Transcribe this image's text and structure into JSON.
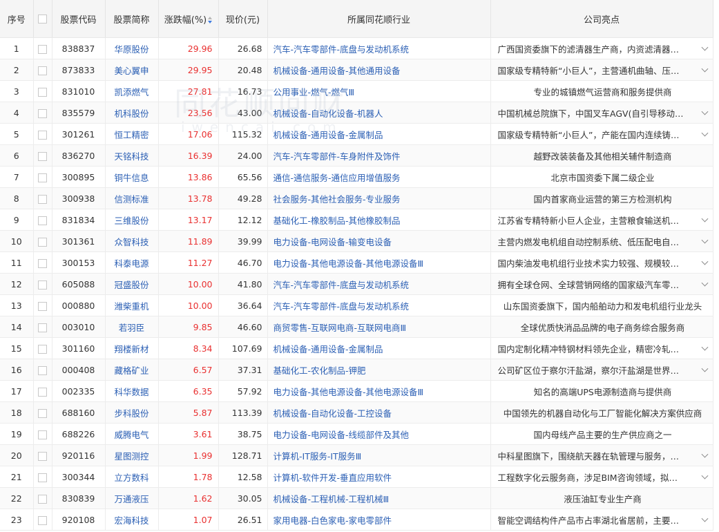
{
  "header": {
    "idx": "序号",
    "code": "股票代码",
    "name": "股票简称",
    "change": "涨跌幅(%)",
    "price": "现价(元)",
    "industry": "所属同花顺行业",
    "highlight": "公司亮点"
  },
  "watermark": {
    "main": "同花顺问财",
    "sub": "iwencai.com"
  },
  "colors": {
    "up": "#e93030",
    "link": "#2b5fb4"
  },
  "rows": [
    {
      "idx": "1",
      "code": "838837",
      "name": "华原股份",
      "change": "29.96",
      "price": "26.68",
      "industry": "汽车-汽车零部件-底盘与发动机系统",
      "highlight": "广西国资委旗下的滤清器生产商，内资滤清器…",
      "expandable": true
    },
    {
      "idx": "2",
      "code": "873833",
      "name": "美心翼申",
      "change": "29.95",
      "price": "20.48",
      "industry": "机械设备-通用设备-其他通用设备",
      "highlight": "国家级专精特新“小巨人”，主营通机曲轴、压…",
      "expandable": true
    },
    {
      "idx": "3",
      "code": "831010",
      "name": "凯添燃气",
      "change": "27.81",
      "price": "16.73",
      "industry": "公用事业-燃气-燃气Ⅲ",
      "highlight": "专业的城镇燃气运营商和服务提供商",
      "expandable": false
    },
    {
      "idx": "4",
      "code": "835579",
      "name": "机科股份",
      "change": "23.56",
      "price": "43.00",
      "industry": "机械设备-自动化设备-机器人",
      "highlight": "中国机械总院旗下，中国叉车AGV(自引导移动…",
      "expandable": true
    },
    {
      "idx": "5",
      "code": "301261",
      "name": "恒工精密",
      "change": "17.06",
      "price": "115.32",
      "industry": "机械设备-通用设备-金属制品",
      "highlight": "国家级专精特新“小巨人”，产能在国内连续铸…",
      "expandable": true
    },
    {
      "idx": "6",
      "code": "836270",
      "name": "天铭科技",
      "change": "16.39",
      "price": "24.00",
      "industry": "汽车-汽车零部件-车身附件及饰件",
      "highlight": "越野改装装备及其他相关辅件制造商",
      "expandable": false
    },
    {
      "idx": "7",
      "code": "300895",
      "name": "铜牛信息",
      "change": "13.86",
      "price": "65.56",
      "industry": "通信-通信服务-通信应用增值服务",
      "highlight": "北京市国资委下属二级企业",
      "expandable": false
    },
    {
      "idx": "8",
      "code": "300938",
      "name": "信测标准",
      "change": "13.78",
      "price": "49.28",
      "industry": "社会服务-其他社会服务-专业服务",
      "highlight": "国内首家商业运营的第三方检测机构",
      "expandable": false
    },
    {
      "idx": "9",
      "code": "831834",
      "name": "三维股份",
      "change": "13.17",
      "price": "12.12",
      "industry": "基础化工-橡胶制品-其他橡胶制品",
      "highlight": "江苏省专精特新小巨人企业，主营粮食输送机…",
      "expandable": true
    },
    {
      "idx": "10",
      "code": "301361",
      "name": "众智科技",
      "change": "11.89",
      "price": "39.99",
      "industry": "电力设备-电网设备-输变电设备",
      "highlight": "主营内燃发电机组自动控制系统、低压配电自…",
      "expandable": true
    },
    {
      "idx": "11",
      "code": "300153",
      "name": "科泰电源",
      "change": "11.27",
      "price": "46.70",
      "industry": "电力设备-其他电源设备-其他电源设备Ⅲ",
      "highlight": "国内柴油发电机组行业技术实力较强、规模较…",
      "expandable": true
    },
    {
      "idx": "12",
      "code": "605088",
      "name": "冠盛股份",
      "change": "10.00",
      "price": "41.80",
      "industry": "汽车-汽车零部件-底盘与发动机系统",
      "highlight": "拥有全球仓网、全球营销网络的国家级汽车零…",
      "expandable": true
    },
    {
      "idx": "13",
      "code": "000880",
      "name": "潍柴重机",
      "change": "10.00",
      "price": "36.64",
      "industry": "汽车-汽车零部件-底盘与发动机系统",
      "highlight": "山东国资委旗下，国内船舶动力和发电机组行业龙头",
      "expandable": false
    },
    {
      "idx": "14",
      "code": "003010",
      "name": "若羽臣",
      "change": "9.85",
      "price": "46.60",
      "industry": "商贸零售-互联网电商-互联网电商Ⅲ",
      "highlight": "全球优质快消品品牌的电子商务综合服务商",
      "expandable": false
    },
    {
      "idx": "15",
      "code": "301160",
      "name": "翔楼新材",
      "change": "8.34",
      "price": "107.69",
      "industry": "机械设备-通用设备-金属制品",
      "highlight": "国内定制化精冲特钢材料领先企业，精密冷轧…",
      "expandable": true
    },
    {
      "idx": "16",
      "code": "000408",
      "name": "藏格矿业",
      "change": "6.57",
      "price": "37.31",
      "industry": "基础化工-农化制品-钾肥",
      "highlight": "公司矿区位于察尔汗盐湖，察尔汗盐湖是世界…",
      "expandable": true
    },
    {
      "idx": "17",
      "code": "002335",
      "name": "科华数据",
      "change": "6.35",
      "price": "57.92",
      "industry": "电力设备-其他电源设备-其他电源设备Ⅲ",
      "highlight": "知名的高端UPS电源制造商与提供商",
      "expandable": false
    },
    {
      "idx": "18",
      "code": "688160",
      "name": "步科股份",
      "change": "5.87",
      "price": "113.39",
      "industry": "机械设备-自动化设备-工控设备",
      "highlight": "中国领先的机器自动化与工厂智能化解决方案供应商",
      "expandable": false
    },
    {
      "idx": "19",
      "code": "688226",
      "name": "威腾电气",
      "change": "3.61",
      "price": "38.75",
      "industry": "电力设备-电网设备-线缆部件及其他",
      "highlight": "国内母线产品主要的生产供应商之一",
      "expandable": false
    },
    {
      "idx": "20",
      "code": "920116",
      "name": "星图测控",
      "change": "1.99",
      "price": "128.71",
      "industry": "计算机-IT服务-IT服务Ⅲ",
      "highlight": "中科星图旗下，围绕航天器在轨管理与服务，…",
      "expandable": true
    },
    {
      "idx": "21",
      "code": "300344",
      "name": "立方数科",
      "change": "1.78",
      "price": "12.58",
      "industry": "计算机-软件开发-垂直应用软件",
      "highlight": "工程数字化云服务商，涉足BIM咨询领域，拟…",
      "expandable": true
    },
    {
      "idx": "22",
      "code": "830839",
      "name": "万通液压",
      "change": "1.62",
      "price": "30.05",
      "industry": "机械设备-工程机械-工程机械Ⅲ",
      "highlight": "液压油缸专业生产商",
      "expandable": false
    },
    {
      "idx": "23",
      "code": "920108",
      "name": "宏海科技",
      "change": "1.07",
      "price": "26.51",
      "industry": "家用电器-白色家电-家电零部件",
      "highlight": "智能空调结构件产品市占率湖北省居前，主要…",
      "expandable": true
    }
  ]
}
